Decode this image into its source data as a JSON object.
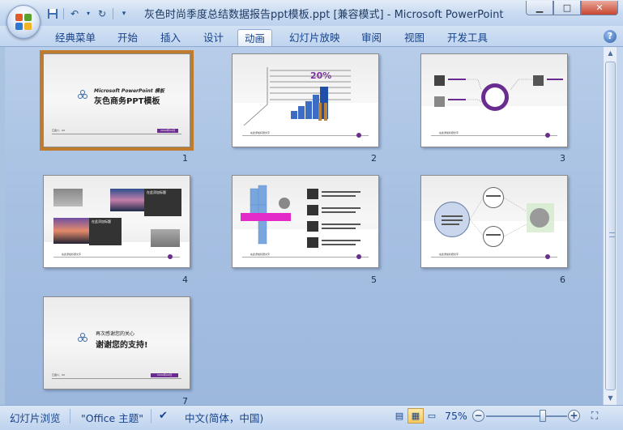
{
  "window": {
    "title": "灰色时尚季度总结数据报告ppt模板.ppt [兼容模式] - Microsoft PowerPoint",
    "controls": [
      "minimize",
      "maximize",
      "close"
    ]
  },
  "quick_access": [
    "save-icon",
    "undo-icon",
    "redo-icon",
    "customize-icon"
  ],
  "ribbon": {
    "tabs": [
      {
        "label": "经典菜单"
      },
      {
        "label": "开始"
      },
      {
        "label": "插入"
      },
      {
        "label": "设计"
      },
      {
        "label": "动画",
        "active": true
      },
      {
        "label": "幻灯片放映"
      },
      {
        "label": "审阅"
      },
      {
        "label": "视图"
      },
      {
        "label": "开发工具"
      }
    ],
    "help": "?"
  },
  "slides": {
    "s1": {
      "num": "1",
      "brand": "Microsoft PowerPoint 模板",
      "title": "灰色商务PPT模板",
      "footer": "汇报人：XX",
      "badge": "XXXX年XX月"
    },
    "s2": {
      "num": "2",
      "percent": "20%",
      "footer": "在此添加标题文字"
    },
    "s3": {
      "num": "3",
      "footer": "在此添加标题文字"
    },
    "s4": {
      "num": "4",
      "label_a": "在此添加标题",
      "label_b": "在此添加标题",
      "footer": "在此添加标题文字"
    },
    "s5": {
      "num": "5",
      "footer": "在此添加标题文字"
    },
    "s6": {
      "num": "6",
      "footer": "在此添加标题文字"
    },
    "s7": {
      "num": "7",
      "small": "再次感谢您的关心",
      "title": "谢谢您的支持!",
      "footer": "汇报人：XX",
      "badge": "XXXX年XX月"
    }
  },
  "status": {
    "view_name": "幻灯片浏览",
    "theme": "\"Office 主题\"",
    "language": "中文(简体，中国)",
    "zoom": "75%",
    "zoom_level_percent": 75
  }
}
